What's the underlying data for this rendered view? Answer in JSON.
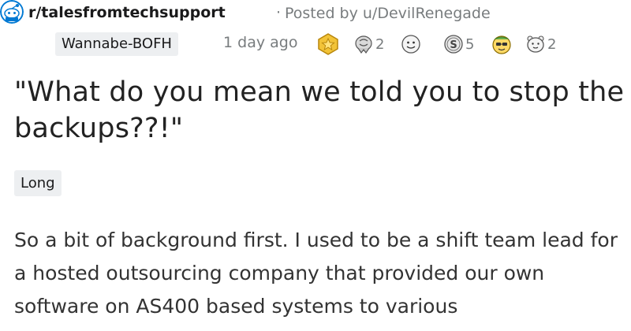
{
  "post_header": {
    "subreddit": "r/talesfromtechsupport",
    "separator": "·",
    "posted_by": "Posted by u/DevilRenegade",
    "user_flair": "Wannabe-BOFH",
    "age": "1 day ago"
  },
  "awards": [
    {
      "icon": "gold-medal-icon",
      "count": ""
    },
    {
      "icon": "silver-award-icon",
      "count": "2"
    },
    {
      "icon": "emoji-face-icon",
      "count": ""
    },
    {
      "icon": "dollar-coin-icon",
      "count": "5"
    },
    {
      "icon": "cool-emoji-icon",
      "count": ""
    },
    {
      "icon": "wholesome-icon",
      "count": "2"
    }
  ],
  "post": {
    "title": "\"What do you mean we told you to stop the backups??!\"",
    "flair": "Long",
    "body": "So a bit of background first. I used to be a shift team lead for a hosted outsourcing company that provided our own software on AS400 based systems to various"
  },
  "colors": {
    "meta_gray": "#787c7e",
    "flair_bg": "#edeff1",
    "award_gold": "#f2c337",
    "text": "#1a1a1b"
  }
}
